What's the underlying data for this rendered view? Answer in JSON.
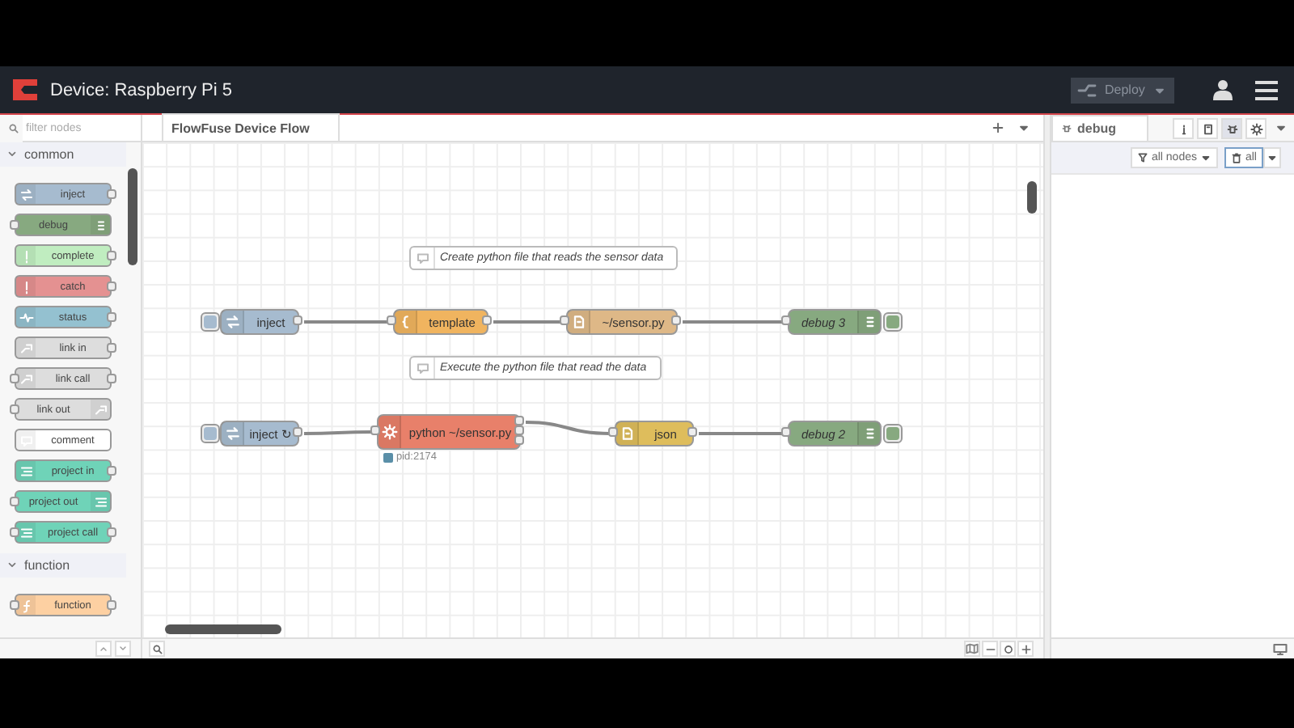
{
  "header": {
    "title": "Device: Raspberry Pi 5",
    "deploy": "Deploy"
  },
  "palette": {
    "filter": {
      "placeholder": "filter nodes"
    },
    "categories": [
      {
        "name": "common",
        "expanded": true,
        "nodes": [
          {
            "label": "inject",
            "kind": "inject"
          },
          {
            "label": "debug",
            "kind": "debug"
          },
          {
            "label": "complete",
            "kind": "complete"
          },
          {
            "label": "catch",
            "kind": "catch"
          },
          {
            "label": "status",
            "kind": "status"
          },
          {
            "label": "link in",
            "kind": "link-in"
          },
          {
            "label": "link call",
            "kind": "link-call"
          },
          {
            "label": "link out",
            "kind": "link-out"
          },
          {
            "label": "comment",
            "kind": "comment"
          },
          {
            "label": "project in",
            "kind": "project-in"
          },
          {
            "label": "project out",
            "kind": "project-out"
          },
          {
            "label": "project call",
            "kind": "project-call"
          }
        ]
      },
      {
        "name": "function",
        "expanded": true,
        "nodes": [
          {
            "label": "function",
            "kind": "function"
          }
        ]
      }
    ]
  },
  "workspace": {
    "tabs": [
      {
        "label": "FlowFuse Device Flow",
        "selected": true
      }
    ],
    "comments": [
      "Create python file that reads the sensor data",
      "Execute the python file that read the data"
    ],
    "nodes": [
      {
        "label": "inject",
        "kind": "inject"
      },
      {
        "label": "template",
        "kind": "template"
      },
      {
        "label": "~/sensor.py",
        "kind": "file"
      },
      {
        "label": "debug 3",
        "kind": "debug",
        "active": true
      },
      {
        "label": "inject ↻",
        "kind": "inject"
      },
      {
        "label": "python ~/sensor.py",
        "kind": "exec",
        "status": "pid:2174"
      },
      {
        "label": "json",
        "kind": "json"
      },
      {
        "label": "debug 2",
        "kind": "debug",
        "active": true
      }
    ]
  },
  "sidebar": {
    "tabs": [
      {
        "label": "debug",
        "selected": true
      }
    ],
    "panel_buttons": [
      {
        "kind": "info",
        "selected": false
      },
      {
        "kind": "book",
        "selected": false
      },
      {
        "kind": "bug",
        "selected": true
      },
      {
        "kind": "gear",
        "selected": false
      }
    ],
    "filter": "all nodes",
    "clear": "all"
  }
}
